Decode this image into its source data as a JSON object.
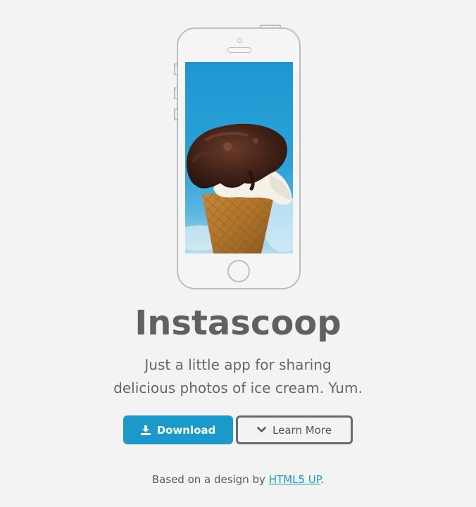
{
  "hero": {
    "title": "Instascoop",
    "tagline_line1": "Just a little app for sharing",
    "tagline_line2": "delicious photos of ice cream. Yum."
  },
  "buttons": {
    "download_label": "Download",
    "download_icon": "download-icon",
    "learn_more_label": "Learn More",
    "learn_more_icon": "chevron-down-icon"
  },
  "footer": {
    "prefix": "Based on a design by",
    "link_text": "HTML5 UP",
    "suffix": "."
  },
  "colors": {
    "background": "#f3f3f3",
    "accent": "#1a9acb",
    "text": "#606060",
    "outline": "#6a6a6a"
  }
}
